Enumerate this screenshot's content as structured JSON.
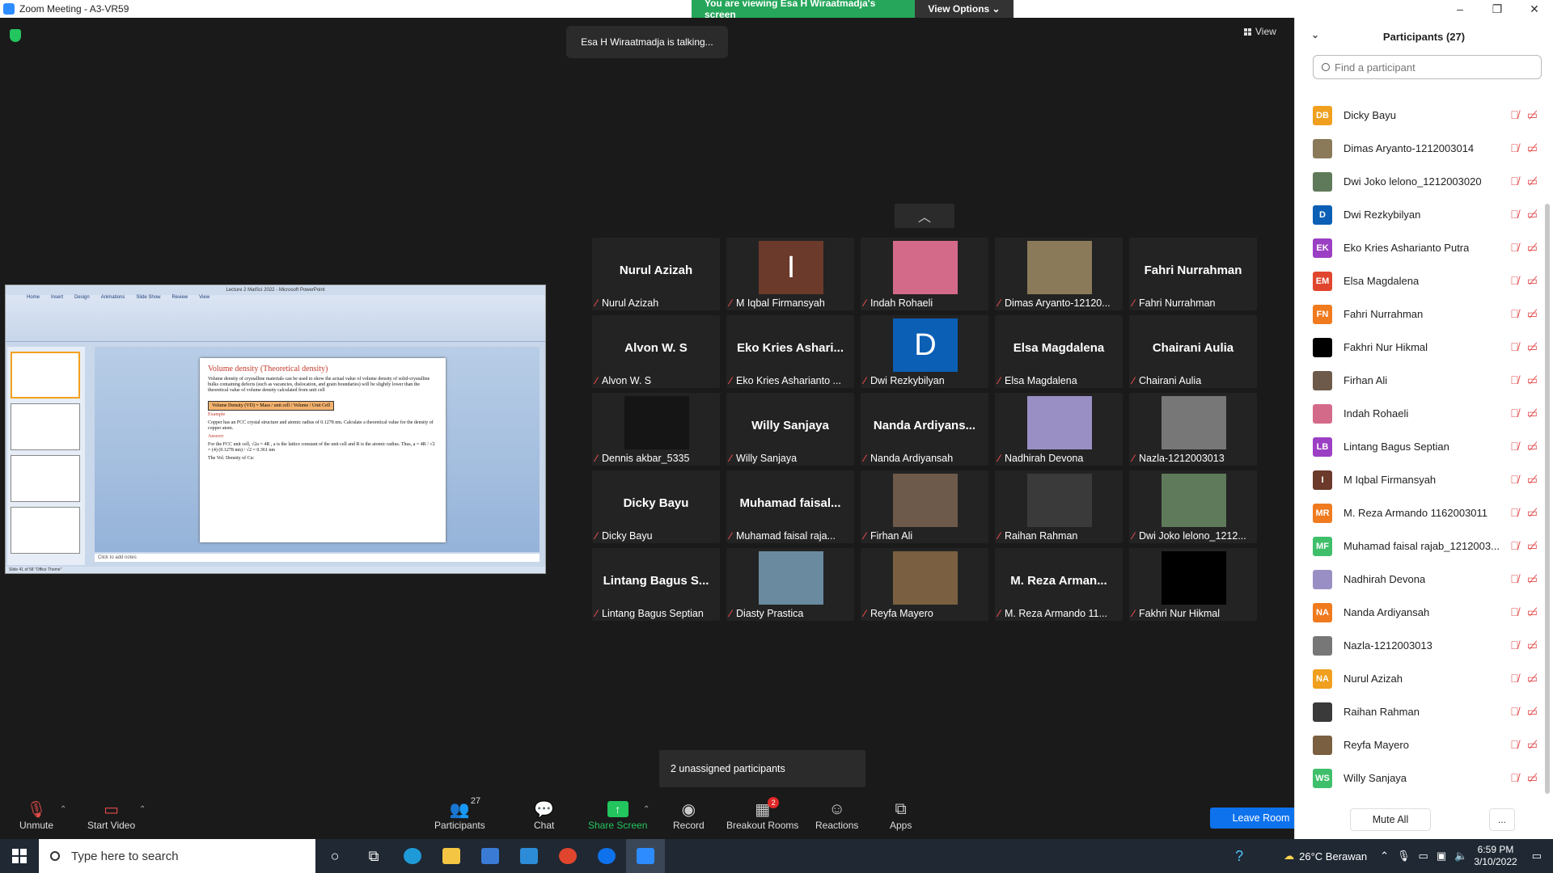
{
  "window": {
    "title": "Zoom Meeting - A3-VR59",
    "minimize": "–",
    "maximize": "❐",
    "close": "✕"
  },
  "banner": {
    "message": "You are viewing Esa H Wiraatmadja's screen",
    "options": "View Options ⌄"
  },
  "talking": "Esa H Wiraatmadja is talking...",
  "view_label": "View",
  "shared_screen": {
    "window_title": "Lecture 2 MatSci 2022 - Microsoft PowerPoint",
    "tabs": [
      "Home",
      "Insert",
      "Design",
      "Animations",
      "Slide Show",
      "Review",
      "View"
    ],
    "slide_title": "Volume density (Theoretical density)",
    "slide_text": "Volume density of crystalline materials can be used to show the actual value of volume density of solid-crystalline bulks containing defects (such as vacancies, dislocation, and grain boundaries) will be slightly lower than the theoretical value of volume density calculated from unit cell",
    "formula": "Volume Density (VD) = Mass / unit cell / Volume / Unit Cell",
    "example_label": "Example",
    "example_text": "Copper has an FCC crystal structure and atomic radius of 0.1278 nm. Calculate a theoretical value for the density of copper atom.",
    "answer_label": "Answer:",
    "answer_text": "For the FCC unit cell, √2a = 4R , a is the lattice constant of the unit cell and R is the atomic radius. Thus, a = 4R / √2 = (4) (0.1278 nm) / √2 = 0.361 nm",
    "vol_density": "The Vol. Density of Cu:",
    "notes": "Click to add notes",
    "status": "Slide 41 of 58   \"Office Theme\""
  },
  "scroll_up": "︿",
  "tiles": [
    {
      "big": "Nurul Azizah",
      "label": "Nurul Azizah"
    },
    {
      "big": "I",
      "label": "M Iqbal Firmansyah",
      "color": "#6b3a2a"
    },
    {
      "big": "",
      "label": "Indah Rohaeli",
      "color": "#d46a8a"
    },
    {
      "big": "",
      "label": "Dimas Aryanto-12120...",
      "color": "#8a7a5a"
    },
    {
      "big": "Fahri Nurrahman",
      "label": "Fahri Nurrahman"
    },
    {
      "big": "Alvon W. S",
      "label": "Alvon W. S"
    },
    {
      "big": "Eko Kries Ashari...",
      "label": "Eko Kries Asharianto ..."
    },
    {
      "big": "D",
      "label": "Dwi Rezkybilyan",
      "color": "#0b5fb5"
    },
    {
      "big": "Elsa Magdalena",
      "label": "Elsa Magdalena"
    },
    {
      "big": "Chairani Aulia",
      "label": "Chairani Aulia"
    },
    {
      "big": "",
      "label": "Dennis akbar_5335",
      "color": "#151515"
    },
    {
      "big": "Willy Sanjaya",
      "label": "Willy Sanjaya"
    },
    {
      "big": "Nanda Ardiyans...",
      "label": "Nanda Ardiyansah"
    },
    {
      "big": "",
      "label": "Nadhirah Devona",
      "color": "#9a8fc4"
    },
    {
      "big": "",
      "label": "Nazla-1212003013",
      "color": "#777777"
    },
    {
      "big": "Dicky Bayu",
      "label": "Dicky Bayu"
    },
    {
      "big": "Muhamad faisal...",
      "label": "Muhamad faisal raja..."
    },
    {
      "big": "",
      "label": "Firhan Ali",
      "color": "#6e5a4a"
    },
    {
      "big": "",
      "label": "Raihan Rahman",
      "color": "#3a3a3a"
    },
    {
      "big": "",
      "label": "Dwi Joko lelono_1212...",
      "color": "#5f7a5a"
    },
    {
      "big": "Lintang Bagus S...",
      "label": "Lintang Bagus Septian"
    },
    {
      "big": "",
      "label": "Diasty Prastica",
      "color": "#6a8aa0"
    },
    {
      "big": "",
      "label": "Reyfa Mayero",
      "color": "#7a6040"
    },
    {
      "big": "M. Reza Arman...",
      "label": "M. Reza Armando 11..."
    },
    {
      "big": "",
      "label": "Fakhri Nur Hikmal",
      "color": "#000000"
    }
  ],
  "unassigned": "2 unassigned participants",
  "toolbar": {
    "unmute": "Unmute",
    "start_video": "Start Video",
    "participants": "Participants",
    "participants_count": "27",
    "chat": "Chat",
    "share_screen": "Share Screen",
    "record": "Record",
    "breakout": "Breakout Rooms",
    "breakout_badge": "2",
    "reactions": "Reactions",
    "apps": "Apps",
    "leave": "Leave Room"
  },
  "panel": {
    "title": "Participants (27)",
    "search_placeholder": "Find a participant",
    "mute_all": "Mute All",
    "more": "...",
    "participants": [
      {
        "initials": "DB",
        "name": "Dicky Bayu",
        "color": "#f0a01e"
      },
      {
        "initials": "",
        "name": "Dimas Aryanto-1212003014",
        "color": "#8a7a5a"
      },
      {
        "initials": "",
        "name": "Dwi Joko lelono_1212003020",
        "color": "#5f7a5a"
      },
      {
        "initials": "D",
        "name": "Dwi Rezkybilyan",
        "color": "#0b5fb5"
      },
      {
        "initials": "EK",
        "name": "Eko Kries Asharianto Putra",
        "color": "#9b3fc4"
      },
      {
        "initials": "EM",
        "name": "Elsa Magdalena",
        "color": "#e0452e"
      },
      {
        "initials": "FN",
        "name": "Fahri Nurrahman",
        "color": "#f07a1e"
      },
      {
        "initials": "",
        "name": "Fakhri Nur Hikmal",
        "color": "#000000"
      },
      {
        "initials": "",
        "name": "Firhan Ali",
        "color": "#6e5a4a"
      },
      {
        "initials": "",
        "name": "Indah Rohaeli",
        "color": "#d46a8a"
      },
      {
        "initials": "LB",
        "name": "Lintang Bagus Septian",
        "color": "#9b3fc4"
      },
      {
        "initials": "I",
        "name": "M Iqbal Firmansyah",
        "color": "#6b3a2a"
      },
      {
        "initials": "MR",
        "name": "M. Reza Armando 1162003011",
        "color": "#f07a1e"
      },
      {
        "initials": "MF",
        "name": "Muhamad faisal rajab_1212003...",
        "color": "#3fbf6a"
      },
      {
        "initials": "",
        "name": "Nadhirah Devona",
        "color": "#9a8fc4"
      },
      {
        "initials": "NA",
        "name": "Nanda Ardiyansah",
        "color": "#f07a1e"
      },
      {
        "initials": "",
        "name": "Nazla-1212003013",
        "color": "#777777"
      },
      {
        "initials": "NA",
        "name": "Nurul Azizah",
        "color": "#f0a01e"
      },
      {
        "initials": "",
        "name": "Raihan Rahman",
        "color": "#3a3a3a"
      },
      {
        "initials": "",
        "name": "Reyfa Mayero",
        "color": "#7a6040"
      },
      {
        "initials": "WS",
        "name": "Willy Sanjaya",
        "color": "#3fbf6a"
      }
    ]
  },
  "taskbar": {
    "search_placeholder": "Type here to search",
    "weather": "26°C  Berawan",
    "time": "6:59 PM",
    "date": "3/10/2022"
  }
}
